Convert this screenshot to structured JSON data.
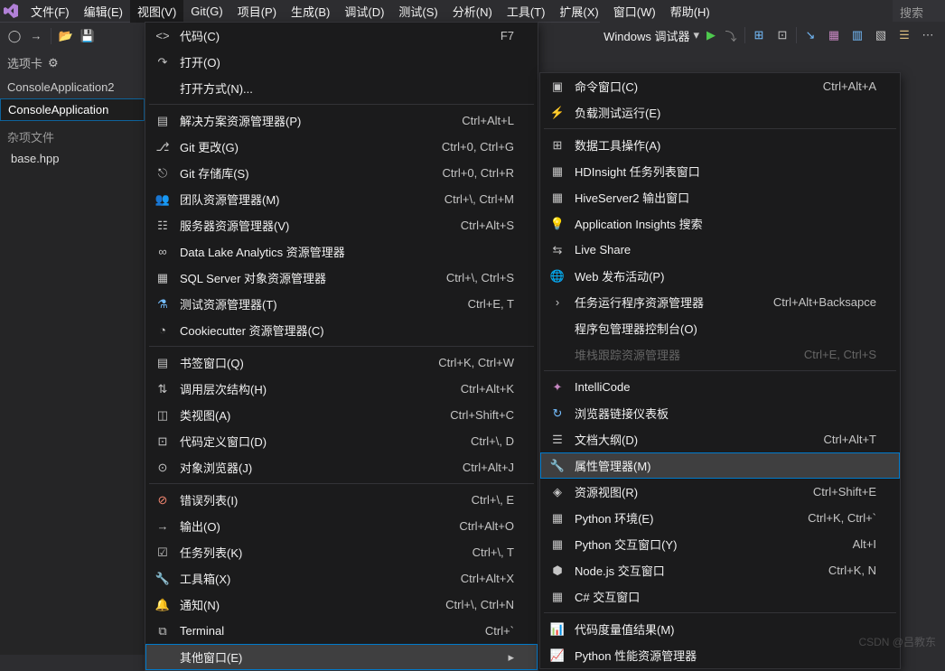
{
  "menubar": {
    "items": [
      "文件(F)",
      "编辑(E)",
      "视图(V)",
      "Git(G)",
      "项目(P)",
      "生成(B)",
      "调试(D)",
      "测试(S)",
      "分析(N)",
      "工具(T)",
      "扩展(X)",
      "窗口(W)",
      "帮助(H)"
    ],
    "active_index": 2,
    "search_placeholder": "搜索 (Ct"
  },
  "toolbar": {
    "debugger_label": "Windows 调试器"
  },
  "sidebar": {
    "header": "选项卡",
    "tabs": [
      "ConsoleApplication2",
      "ConsoleApplication"
    ],
    "section_label": "杂项文件",
    "files": [
      "base.hpp"
    ]
  },
  "menu1": [
    {
      "icon": "code",
      "label": "代码(C)",
      "shortcut": "F7"
    },
    {
      "icon": "open",
      "label": "打开(O)",
      "shortcut": ""
    },
    {
      "icon": "",
      "label": "打开方式(N)...",
      "shortcut": ""
    },
    {
      "sep": true
    },
    {
      "icon": "solution",
      "label": "解决方案资源管理器(P)",
      "shortcut": "Ctrl+Alt+L"
    },
    {
      "icon": "git",
      "label": "Git 更改(G)",
      "shortcut": "Ctrl+0, Ctrl+G"
    },
    {
      "icon": "git-repo",
      "label": "Git 存储库(S)",
      "shortcut": "Ctrl+0, Ctrl+R"
    },
    {
      "icon": "team",
      "label": "团队资源管理器(M)",
      "shortcut": "Ctrl+\\, Ctrl+M"
    },
    {
      "icon": "server",
      "label": "服务器资源管理器(V)",
      "shortcut": "Ctrl+Alt+S"
    },
    {
      "icon": "datalake",
      "label": "Data Lake Analytics 资源管理器",
      "shortcut": ""
    },
    {
      "icon": "sql",
      "label": "SQL Server 对象资源管理器",
      "shortcut": "Ctrl+\\, Ctrl+S"
    },
    {
      "icon": "test",
      "label": "测试资源管理器(T)",
      "shortcut": "Ctrl+E, T"
    },
    {
      "icon": "cookie",
      "label": "Cookiecutter 资源管理器(C)",
      "shortcut": ""
    },
    {
      "sep": true
    },
    {
      "icon": "bookmark",
      "label": "书签窗口(Q)",
      "shortcut": "Ctrl+K, Ctrl+W"
    },
    {
      "icon": "hierarchy",
      "label": "调用层次结构(H)",
      "shortcut": "Ctrl+Alt+K"
    },
    {
      "icon": "class",
      "label": "类视图(A)",
      "shortcut": "Ctrl+Shift+C"
    },
    {
      "icon": "codedef",
      "label": "代码定义窗口(D)",
      "shortcut": "Ctrl+\\, D"
    },
    {
      "icon": "object",
      "label": "对象浏览器(J)",
      "shortcut": "Ctrl+Alt+J"
    },
    {
      "sep": true
    },
    {
      "icon": "error",
      "label": "错误列表(I)",
      "shortcut": "Ctrl+\\, E"
    },
    {
      "icon": "output",
      "label": "输出(O)",
      "shortcut": "Ctrl+Alt+O"
    },
    {
      "icon": "tasks",
      "label": "任务列表(K)",
      "shortcut": "Ctrl+\\, T"
    },
    {
      "icon": "toolbox",
      "label": "工具箱(X)",
      "shortcut": "Ctrl+Alt+X"
    },
    {
      "icon": "bell",
      "label": "通知(N)",
      "shortcut": "Ctrl+\\, Ctrl+N"
    },
    {
      "icon": "terminal",
      "label": "Terminal",
      "shortcut": "Ctrl+`"
    },
    {
      "icon": "",
      "label": "其他窗口(E)",
      "shortcut": "",
      "arrow": true,
      "hover": true
    }
  ],
  "menu2": [
    {
      "icon": "cmd",
      "label": "命令窗口(C)",
      "shortcut": "Ctrl+Alt+A"
    },
    {
      "icon": "loadtest",
      "label": "负载测试运行(E)",
      "shortcut": ""
    },
    {
      "sep": true
    },
    {
      "icon": "datatool",
      "label": "数据工具操作(A)",
      "shortcut": ""
    },
    {
      "icon": "hdinsight",
      "label": "HDInsight 任务列表窗口",
      "shortcut": ""
    },
    {
      "icon": "hive",
      "label": "HiveServer2 输出窗口",
      "shortcut": ""
    },
    {
      "icon": "lightbulb",
      "label": "Application Insights 搜索",
      "shortcut": ""
    },
    {
      "icon": "liveshare",
      "label": "Live Share",
      "shortcut": ""
    },
    {
      "icon": "web",
      "label": "Web 发布活动(P)",
      "shortcut": ""
    },
    {
      "icon": "taskrunner",
      "label": "任务运行程序资源管理器",
      "shortcut": "Ctrl+Alt+Backsapce"
    },
    {
      "icon": "",
      "label": "程序包管理器控制台(O)",
      "shortcut": ""
    },
    {
      "icon": "",
      "label": "堆栈跟踪资源管理器",
      "shortcut": "Ctrl+E, Ctrl+S",
      "disabled": true
    },
    {
      "sep": true
    },
    {
      "icon": "intellicode",
      "label": "IntelliCode",
      "shortcut": ""
    },
    {
      "icon": "browserlink",
      "label": "浏览器链接仪表板",
      "shortcut": ""
    },
    {
      "icon": "outline",
      "label": "文档大纲(D)",
      "shortcut": "Ctrl+Alt+T"
    },
    {
      "icon": "wrench",
      "label": "属性管理器(M)",
      "shortcut": "",
      "hover": true
    },
    {
      "icon": "resource",
      "label": "资源视图(R)",
      "shortcut": "Ctrl+Shift+E"
    },
    {
      "icon": "pyenv",
      "label": "Python 环境(E)",
      "shortcut": "Ctrl+K, Ctrl+`"
    },
    {
      "icon": "pyint",
      "label": "Python 交互窗口(Y)",
      "shortcut": "Alt+I"
    },
    {
      "icon": "nodejs",
      "label": "Node.js 交互窗口",
      "shortcut": "Ctrl+K, N"
    },
    {
      "icon": "csharp",
      "label": "C# 交互窗口",
      "shortcut": ""
    },
    {
      "sep": true
    },
    {
      "icon": "metrics",
      "label": "代码度量值结果(M)",
      "shortcut": ""
    },
    {
      "icon": "pyperf",
      "label": "Python 性能资源管理器",
      "shortcut": ""
    }
  ],
  "watermark": "CSDN @吕教东"
}
